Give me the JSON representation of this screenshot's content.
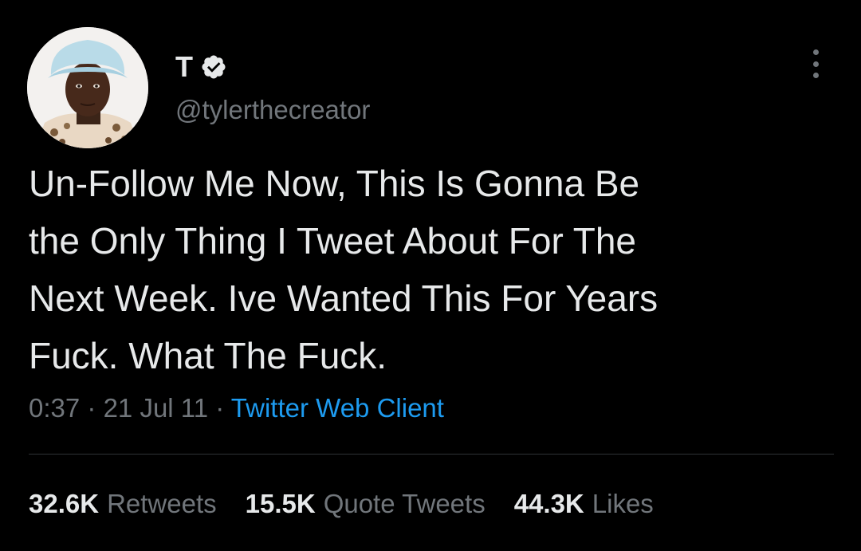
{
  "tweet": {
    "author": {
      "display_name": "T",
      "handle": "@tylerthecreator",
      "verified": true
    },
    "text": "Un-Follow Me Now, This Is Gonna Be\nthe Only Thing I Tweet About For The\nNext Week. Ive Wanted This For Years\nFuck. What The Fuck.",
    "time": "0:37",
    "date": "21 Jul 11",
    "separator": "·",
    "source": "Twitter Web Client",
    "stats": {
      "retweets": {
        "count": "32.6K",
        "label": "Retweets"
      },
      "quote_tweets": {
        "count": "15.5K",
        "label": "Quote Tweets"
      },
      "likes": {
        "count": "44.3K",
        "label": "Likes"
      }
    }
  },
  "icons": {
    "verified": "verified-badge-icon",
    "more": "more-options-icon"
  },
  "colors": {
    "background": "#000000",
    "primary_text": "#e7e9ea",
    "secondary_text": "#71767b",
    "link": "#1d9bf0",
    "divider": "#2f3336"
  }
}
